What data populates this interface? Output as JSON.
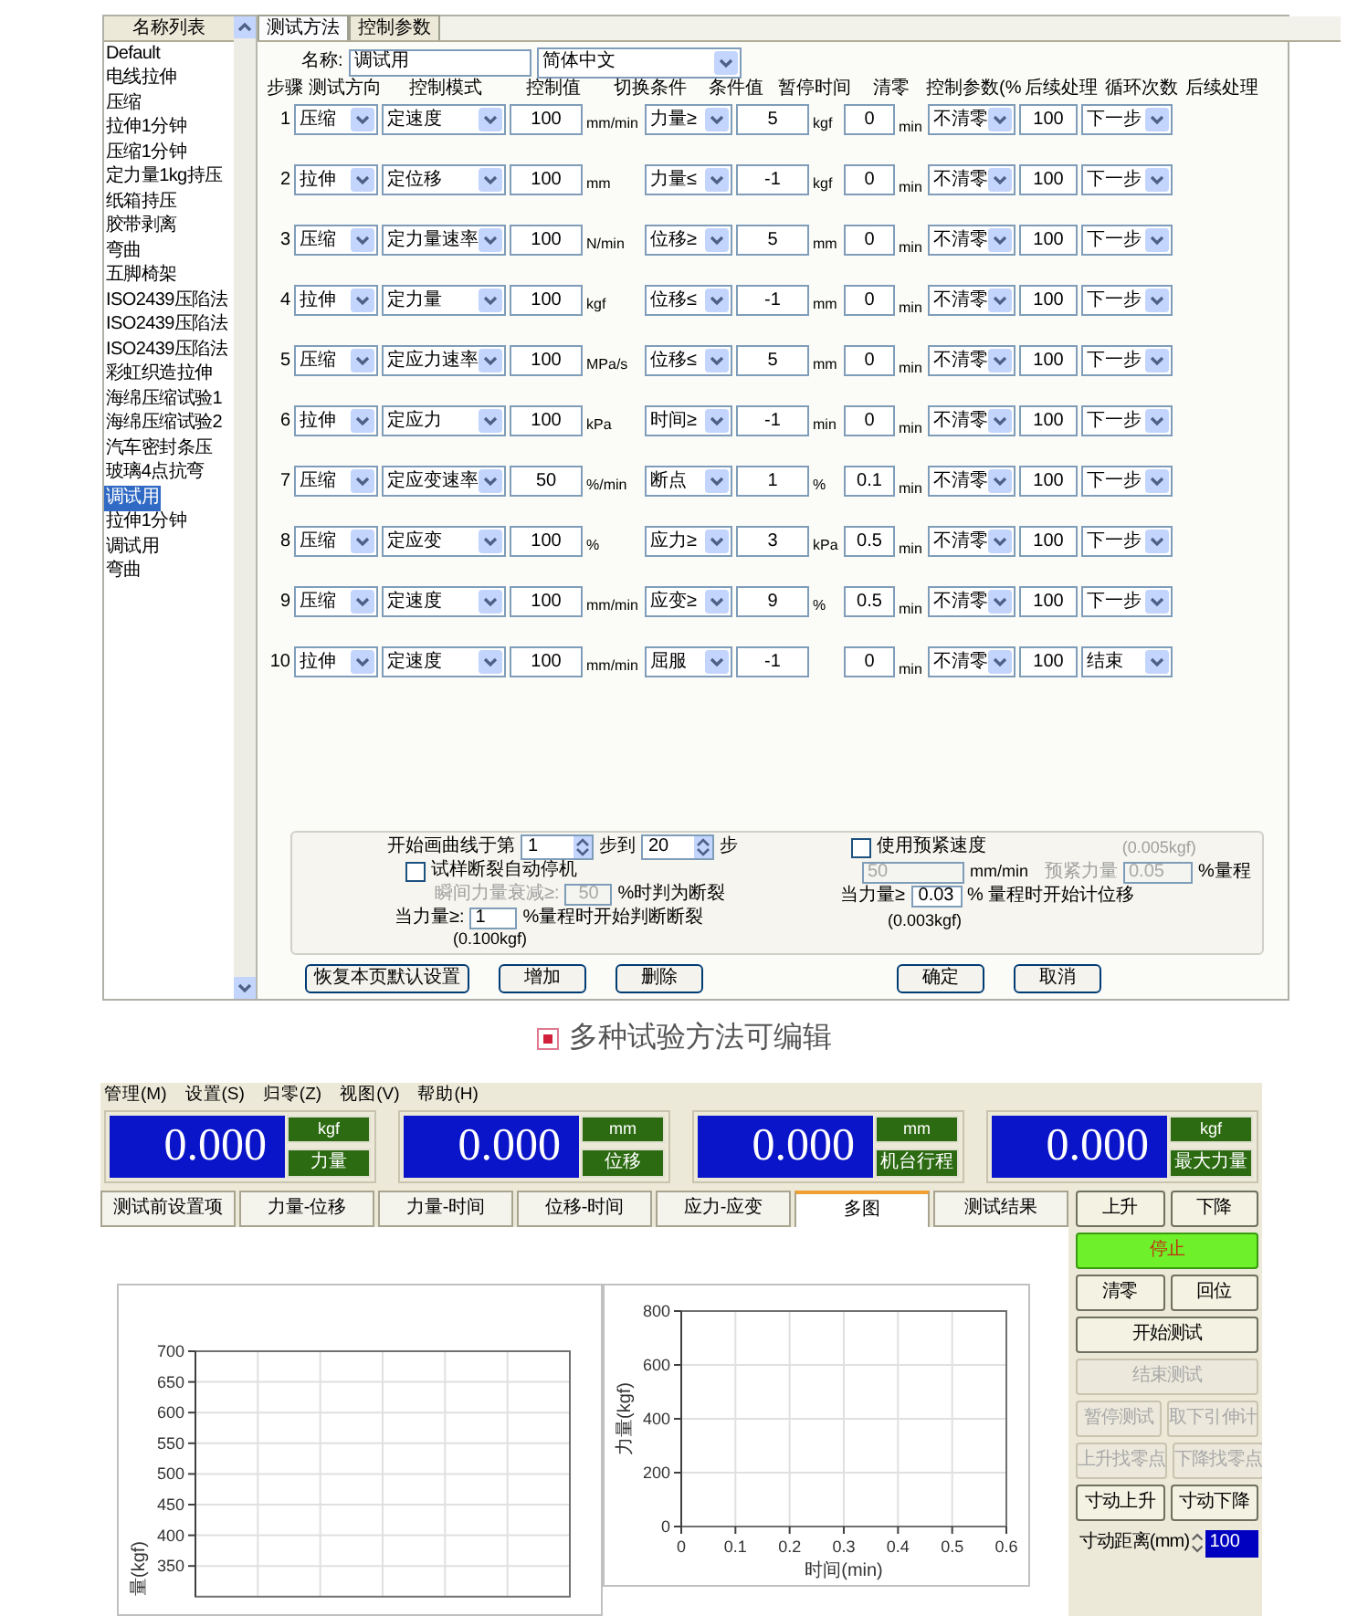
{
  "top_window": {
    "sidebar": {
      "header": "名称列表",
      "items": [
        {
          "label": "Default",
          "selected": false
        },
        {
          "label": "电线拉伸",
          "selected": false
        },
        {
          "label": "压缩",
          "selected": false
        },
        {
          "label": "拉伸1分钟",
          "selected": false
        },
        {
          "label": "压缩1分钟",
          "selected": false
        },
        {
          "label": "定力量1kg持压",
          "selected": false
        },
        {
          "label": "纸箱持压",
          "selected": false
        },
        {
          "label": "胶带剥离",
          "selected": false
        },
        {
          "label": "弯曲",
          "selected": false
        },
        {
          "label": "五脚椅架",
          "selected": false
        },
        {
          "label": "ISO2439压陷法",
          "selected": false
        },
        {
          "label": "ISO2439压陷法",
          "selected": false
        },
        {
          "label": "ISO2439压陷法",
          "selected": false
        },
        {
          "label": "彩虹织造拉伸",
          "selected": false
        },
        {
          "label": "海绵压缩试验1",
          "selected": false
        },
        {
          "label": "海绵压缩试验2",
          "selected": false
        },
        {
          "label": "汽车密封条压",
          "selected": false
        },
        {
          "label": "玻璃4点抗弯",
          "selected": false
        },
        {
          "label": "调试用",
          "selected": true
        },
        {
          "label": "拉伸1分钟",
          "selected": false
        },
        {
          "label": "调试用",
          "selected": false
        },
        {
          "label": "弯曲",
          "selected": false
        }
      ]
    },
    "tabs": [
      {
        "label": "测试方法",
        "selected": true
      },
      {
        "label": "控制参数",
        "selected": false
      }
    ],
    "name_label": "名称:",
    "name_value": "调试用",
    "language": "简体中文",
    "columns": [
      "步骤",
      "测试方向",
      "控制模式",
      "控制值",
      "切换条件",
      "条件值",
      "暂停时间",
      "清零",
      "控制参数(%",
      "后续处理",
      "循环次数",
      "后续处理"
    ],
    "steps": [
      {
        "step": "1",
        "direction": "压缩",
        "mode": "定速度",
        "value": "100",
        "unit": "mm/min",
        "switch": "力量≥",
        "cond_value": "5",
        "cond_unit": "kgf",
        "pause": "0",
        "pause_unit": "min",
        "clear": "不清零",
        "ctrl_param": "100",
        "next": "下一步"
      },
      {
        "step": "2",
        "direction": "拉伸",
        "mode": "定位移",
        "value": "100",
        "unit": "mm",
        "switch": "力量≤",
        "cond_value": "-1",
        "cond_unit": "kgf",
        "pause": "0",
        "pause_unit": "min",
        "clear": "不清零",
        "ctrl_param": "100",
        "next": "下一步"
      },
      {
        "step": "3",
        "direction": "压缩",
        "mode": "定力量速率",
        "value": "100",
        "unit": "N/min",
        "switch": "位移≥",
        "cond_value": "5",
        "cond_unit": "mm",
        "pause": "0",
        "pause_unit": "min",
        "clear": "不清零",
        "ctrl_param": "100",
        "next": "下一步"
      },
      {
        "step": "4",
        "direction": "拉伸",
        "mode": "定力量",
        "value": "100",
        "unit": "kgf",
        "switch": "位移≤",
        "cond_value": "-1",
        "cond_unit": "mm",
        "pause": "0",
        "pause_unit": "min",
        "clear": "不清零",
        "ctrl_param": "100",
        "next": "下一步"
      },
      {
        "step": "5",
        "direction": "压缩",
        "mode": "定应力速率",
        "value": "100",
        "unit": "MPa/s",
        "switch": "位移≤",
        "cond_value": "5",
        "cond_unit": "mm",
        "pause": "0",
        "pause_unit": "min",
        "clear": "不清零",
        "ctrl_param": "100",
        "next": "下一步"
      },
      {
        "step": "6",
        "direction": "拉伸",
        "mode": "定应力",
        "value": "100",
        "unit": "kPa",
        "switch": "时间≥",
        "cond_value": "-1",
        "cond_unit": "min",
        "pause": "0",
        "pause_unit": "min",
        "clear": "不清零",
        "ctrl_param": "100",
        "next": "下一步"
      },
      {
        "step": "7",
        "direction": "压缩",
        "mode": "定应变速率",
        "value": "50",
        "unit": "%/min",
        "switch": "断点",
        "cond_value": "1",
        "cond_unit": "%",
        "pause": "0.1",
        "pause_unit": "min",
        "clear": "不清零",
        "ctrl_param": "100",
        "next": "下一步"
      },
      {
        "step": "8",
        "direction": "压缩",
        "mode": "定应变",
        "value": "100",
        "unit": "%",
        "switch": "应力≥",
        "cond_value": "3",
        "cond_unit": "kPa",
        "pause": "0.5",
        "pause_unit": "min",
        "clear": "不清零",
        "ctrl_param": "100",
        "next": "下一步"
      },
      {
        "step": "9",
        "direction": "压缩",
        "mode": "定速度",
        "value": "100",
        "unit": "mm/min",
        "switch": "应变≥",
        "cond_value": "9",
        "cond_unit": "%",
        "pause": "0.5",
        "pause_unit": "min",
        "clear": "不清零",
        "ctrl_param": "100",
        "next": "下一步"
      },
      {
        "step": "10",
        "direction": "拉伸",
        "mode": "定速度",
        "value": "100",
        "unit": "mm/min",
        "switch": "屈服",
        "cond_value": "-1",
        "pause": "0",
        "pause_unit": "min",
        "clear": "不清零",
        "ctrl_param": "100",
        "next": "结束"
      }
    ],
    "options": {
      "curve_start": {
        "label": "开始画曲线于第",
        "from": "1",
        "mid": "步到",
        "to": "20",
        "end": "步"
      },
      "auto_stop": {
        "label": "试样断裂自动停机",
        "checked": false
      },
      "drop_threshold": {
        "label": "瞬间力量衰减≥:",
        "value": "50",
        "suffix": "%时判为断裂",
        "disabled": true
      },
      "break_start": {
        "label": "当力量≥:",
        "value": "1",
        "suffix": "%量程时开始判断断裂",
        "note": "(0.100kgf)"
      },
      "preload": {
        "label": "使用预紧速度",
        "checked": false,
        "note": "(0.005kgf)",
        "speed": "50",
        "speed_unit": "mm/min",
        "force_label": "预紧力量",
        "force": "0.05",
        "force_unit": "%量程",
        "disabled": true
      },
      "displacement_start": {
        "label": "当力量≥",
        "value": "0.03",
        "suffix": "% 量程时开始计位移",
        "note": "(0.003kgf)"
      }
    },
    "buttons": [
      "恢复本页默认设置",
      "增加",
      "删除",
      "确定",
      "取消"
    ]
  },
  "caption": "多种试验方法可编辑",
  "main_window": {
    "menu": [
      "管理(M)",
      "设置(S)",
      "归零(Z)",
      "视图(V)",
      "帮助(H)"
    ],
    "readouts": [
      {
        "value": "0.000",
        "unit": "kgf",
        "label": "力量"
      },
      {
        "value": "0.000",
        "unit": "mm",
        "label": "位移"
      },
      {
        "value": "0.000",
        "unit": "mm",
        "label": "机台行程"
      },
      {
        "value": "0.000",
        "unit": "kgf",
        "label": "最大力量"
      }
    ],
    "tabs": [
      {
        "label": "测试前设置项",
        "selected": false
      },
      {
        "label": "力量-位移",
        "selected": false
      },
      {
        "label": "力量-时间",
        "selected": false
      },
      {
        "label": "位移-时间",
        "selected": false
      },
      {
        "label": "应力-应变",
        "selected": false
      },
      {
        "label": "多图",
        "selected": true
      },
      {
        "label": "测试结果",
        "selected": false
      }
    ],
    "controls": [
      [
        {
          "label": "上升",
          "disabled": false,
          "highlighted": false
        },
        {
          "label": "下降",
          "disabled": false,
          "highlighted": false
        }
      ],
      [
        {
          "label": "停止",
          "disabled": false,
          "highlighted": true
        }
      ],
      [
        {
          "label": "清零",
          "disabled": false,
          "highlighted": false
        },
        {
          "label": "回位",
          "disabled": false,
          "highlighted": false
        }
      ],
      [
        {
          "label": "开始测试",
          "disabled": false,
          "highlighted": false
        }
      ],
      [
        {
          "label": "结束测试",
          "disabled": true,
          "highlighted": false
        }
      ],
      [
        {
          "label": "暂停测试",
          "disabled": true,
          "highlighted": false
        },
        {
          "label": "取下引伸计",
          "disabled": true,
          "highlighted": false
        }
      ],
      [
        {
          "label": "上升找零点",
          "disabled": true,
          "highlighted": false
        },
        {
          "label": "下降找零点",
          "disabled": true,
          "highlighted": false
        }
      ],
      [
        {
          "label": "寸动上升",
          "disabled": false,
          "highlighted": false
        },
        {
          "label": "寸动下降",
          "disabled": false,
          "highlighted": false
        }
      ]
    ],
    "jog_distance": {
      "label": "寸动距离(mm)",
      "value": "100"
    },
    "charts": [
      {
        "chart_data": {
          "type": "line",
          "categories": [
            null,
            null,
            null,
            null,
            null,
            null
          ],
          "ylim": [
            300,
            700
          ],
          "ylabel": "量(kgf)",
          "yticks": [
            350,
            400,
            450,
            500,
            550,
            600,
            650,
            700
          ],
          "grid": true
        }
      },
      {
        "chart_data": {
          "type": "line",
          "grid": true,
          "xlabel": "时间(min)",
          "ylabel": "力量(kgf)",
          "xlim": [
            0,
            0.6
          ],
          "ylim": [
            0,
            800
          ],
          "xticks": [
            0,
            0.1,
            0.2,
            0.3,
            0.4,
            0.5,
            0.6
          ],
          "yticks": [
            0,
            200,
            400,
            600,
            800
          ]
        }
      }
    ]
  }
}
